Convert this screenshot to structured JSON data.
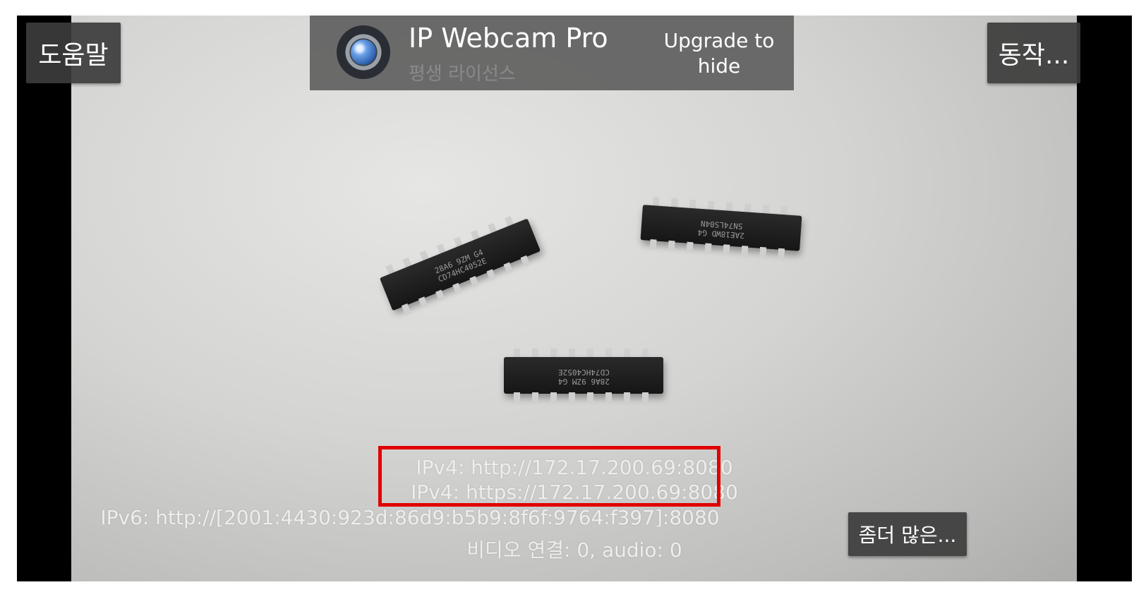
{
  "header": {
    "help_label": "도움말",
    "actions_label": "동작...",
    "app_name": "IP Webcam Pro",
    "license": "평생 라이선스",
    "upgrade_line1": "Upgrade to",
    "upgrade_line2": "hide"
  },
  "status": {
    "ipv4_http": "IPv4: http://172.17.200.69:8080",
    "ipv4_https": "IPv4: https://172.17.200.69:8080",
    "ipv6_http": "IPv6: http://[2001:4430:923d:86d9:b5b9:8f6f:9764:f397]:8080",
    "connections": "비디오 연결: 0, audio: 0"
  },
  "more_label": "좀더 많은...",
  "chips": [
    {
      "line1": "28A6 9ZM G4",
      "line2": "CD74HC4052E"
    },
    {
      "line1": "2AE18WD G4",
      "line2": "SN74LS04N"
    },
    {
      "line1": "28A6 9ZM G4",
      "line2": "CD74HC4052E"
    }
  ],
  "colors": {
    "highlight": "#e00000",
    "overlay": "#3c3c3c"
  }
}
